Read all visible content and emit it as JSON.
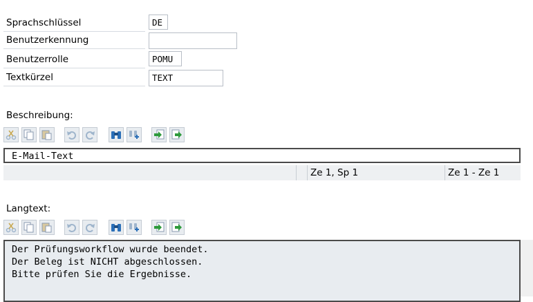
{
  "form": {
    "language_key": {
      "label": "Sprachschlüssel",
      "value": "DE"
    },
    "user_id": {
      "label": "Benutzerkennung",
      "value": ""
    },
    "user_role": {
      "label": "Benutzerrolle",
      "value": "POMU"
    },
    "text_short": {
      "label": "Textkürzel",
      "value": "TEXT"
    }
  },
  "description": {
    "label": "Beschreibung:",
    "text": "E-Mail-Text",
    "status": {
      "position": "Ze 1, Sp 1",
      "range": "Ze 1 - Ze 1"
    }
  },
  "longtext": {
    "label": "Langtext:",
    "lines": [
      "Der Prüfungsworkflow wurde beendet.",
      "Der Beleg ist NICHT abgeschlossen.",
      "Bitte prüfen Sie die Ergebnisse."
    ]
  },
  "toolbar_icons": [
    "cut-icon",
    "copy-icon",
    "paste-icon",
    "undo-icon",
    "redo-icon",
    "find-icon",
    "find-next-icon",
    "import-icon",
    "export-icon"
  ],
  "colors": {
    "icon_blue": "#2a6fb8",
    "icon_green": "#2e9a3c",
    "disabled": "#9fb5cc"
  }
}
